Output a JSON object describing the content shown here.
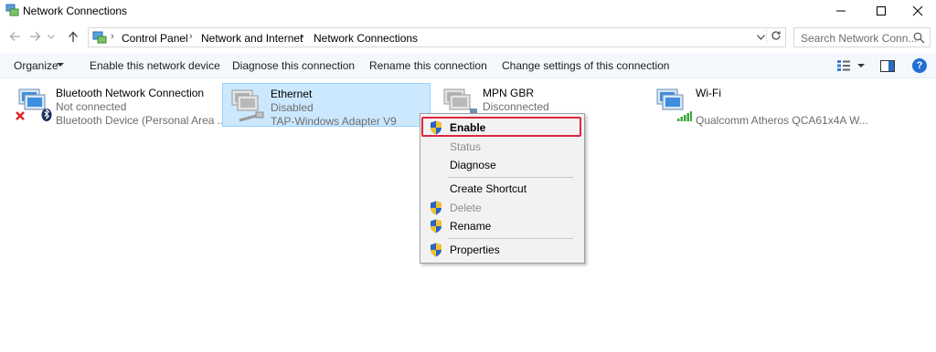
{
  "window": {
    "title": "Network Connections",
    "controls": [
      "minimize-icon",
      "maximize-icon",
      "close-icon"
    ]
  },
  "address": {
    "breadcrumbs": [
      "Control Panel",
      "Network and Internet",
      "Network Connections"
    ],
    "search_placeholder": "Search Network Conn..."
  },
  "toolbar": {
    "organize": "Organize",
    "enable_device": "Enable this network device",
    "diagnose": "Diagnose this connection",
    "rename": "Rename this connection",
    "change_settings": "Change settings of this connection"
  },
  "connections": [
    {
      "name": "Bluetooth Network Connection",
      "status": "Not connected",
      "device": "Bluetooth Device (Personal Area ...",
      "icon": "bluetooth-network-icon"
    },
    {
      "name": "Ethernet",
      "status": "Disabled",
      "device": "TAP-Windows Adapter V9",
      "icon": "ethernet-disabled-icon",
      "selected": true
    },
    {
      "name": "MPN GBR",
      "status": "Disconnected",
      "device": "",
      "icon": "vpn-connection-icon"
    },
    {
      "name": "Wi-Fi",
      "status": "",
      "device": "Qualcomm Atheros QCA61x4A W...",
      "icon": "wifi-network-icon"
    }
  ],
  "context_menu": {
    "items": [
      {
        "label": "Enable",
        "shield": true,
        "bold": true,
        "disabled": false
      },
      {
        "label": "Status",
        "shield": false,
        "bold": false,
        "disabled": true
      },
      {
        "label": "Diagnose",
        "shield": false,
        "bold": false,
        "disabled": false
      },
      {
        "label": "Create Shortcut",
        "shield": false,
        "bold": false,
        "disabled": false
      },
      {
        "label": "Delete",
        "shield": true,
        "bold": false,
        "disabled": true
      },
      {
        "label": "Rename",
        "shield": true,
        "bold": false,
        "disabled": false
      },
      {
        "label": "Properties",
        "shield": true,
        "bold": false,
        "disabled": false
      }
    ]
  },
  "colors": {
    "selection_bg": "#cce8ff",
    "selection_border": "#99d1ff",
    "highlight_outline": "#e0263f",
    "toolbar_bg": "#f4f7fc"
  }
}
